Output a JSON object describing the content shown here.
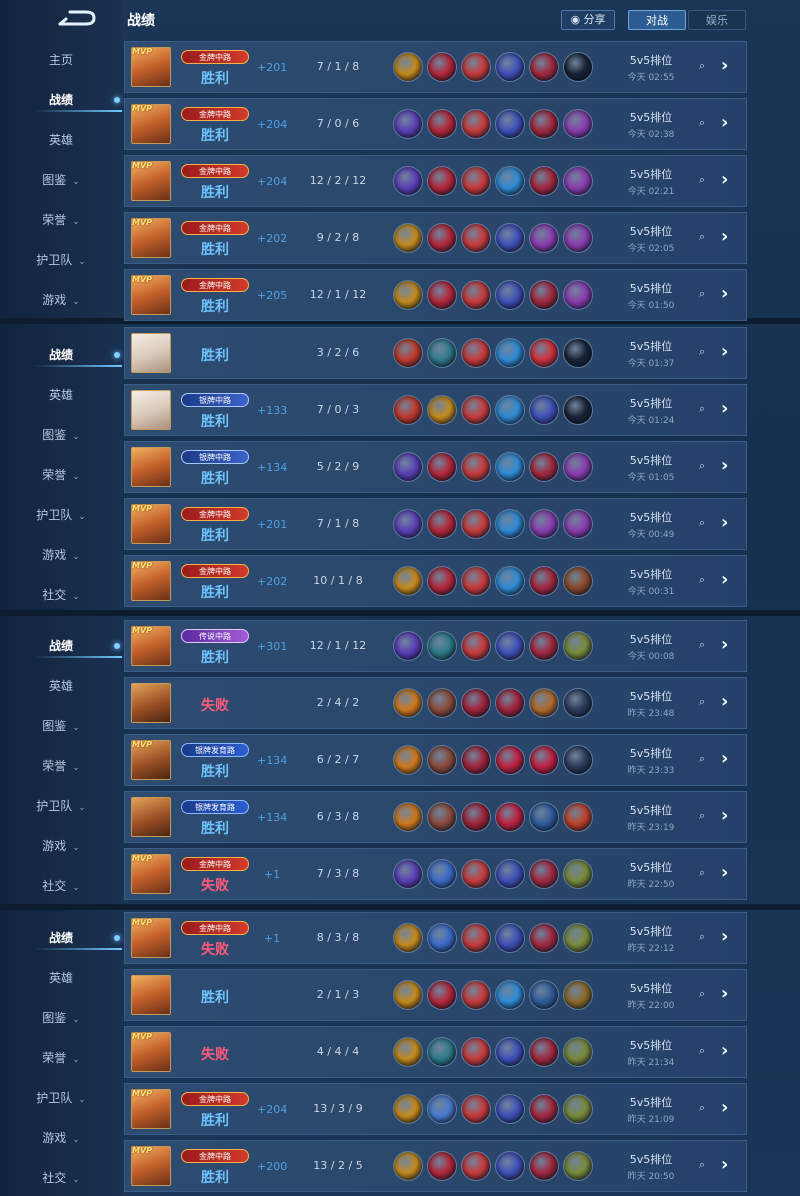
{
  "header": {
    "title": "战绩",
    "share_label": "分享",
    "tab_battle": "对战",
    "tab_fun": "娱乐"
  },
  "sidebar_segments": [
    {
      "items": [
        {
          "label": "主页",
          "caret": false,
          "active": false
        },
        {
          "label": "战绩",
          "caret": false,
          "active": true
        },
        {
          "label": "英雄",
          "caret": false,
          "active": false
        },
        {
          "label": "图鉴",
          "caret": true,
          "active": false
        },
        {
          "label": "荣誉",
          "caret": true,
          "active": false
        },
        {
          "label": "护卫队",
          "caret": true,
          "active": false
        },
        {
          "label": "游戏",
          "caret": true,
          "active": false
        }
      ]
    },
    {
      "items": [
        {
          "label": "战绩",
          "caret": false,
          "active": true
        },
        {
          "label": "英雄",
          "caret": false,
          "active": false
        },
        {
          "label": "图鉴",
          "caret": true,
          "active": false
        },
        {
          "label": "荣誉",
          "caret": true,
          "active": false
        },
        {
          "label": "护卫队",
          "caret": true,
          "active": false
        },
        {
          "label": "游戏",
          "caret": true,
          "active": false
        },
        {
          "label": "社交",
          "caret": true,
          "active": false
        }
      ]
    },
    {
      "items": [
        {
          "label": "战绩",
          "caret": false,
          "active": true
        },
        {
          "label": "英雄",
          "caret": false,
          "active": false
        },
        {
          "label": "图鉴",
          "caret": true,
          "active": false
        },
        {
          "label": "荣誉",
          "caret": true,
          "active": false
        },
        {
          "label": "护卫队",
          "caret": true,
          "active": false
        },
        {
          "label": "游戏",
          "caret": true,
          "active": false
        },
        {
          "label": "社交",
          "caret": true,
          "active": false
        }
      ]
    },
    {
      "items": [
        {
          "label": "战绩",
          "caret": false,
          "active": true
        },
        {
          "label": "英雄",
          "caret": false,
          "active": false
        },
        {
          "label": "图鉴",
          "caret": true,
          "active": false
        },
        {
          "label": "荣誉",
          "caret": true,
          "active": false
        },
        {
          "label": "护卫队",
          "caret": true,
          "active": false
        },
        {
          "label": "游戏",
          "caret": true,
          "active": false
        },
        {
          "label": "社交",
          "caret": true,
          "active": false
        }
      ]
    }
  ],
  "mvp_label": "MVP",
  "matches": [
    {
      "hero": "girl",
      "mvp": true,
      "badge": "金牌中路",
      "badge_style": "gold",
      "result": "胜利",
      "win": true,
      "points": "+201",
      "kda": "7 / 1 / 8",
      "mode": "5v5排位",
      "time": "今天 02:55",
      "items": [
        "#c58a1c",
        "#b3263a",
        "#c73b3b",
        "#3f4fb8",
        "#a1283f",
        "#1a2436"
      ]
    },
    {
      "hero": "girl",
      "mvp": true,
      "badge": "金牌中路",
      "badge_style": "gold",
      "result": "胜利",
      "win": true,
      "points": "+204",
      "kda": "7 / 0 / 6",
      "mode": "5v5排位",
      "time": "今天 02:38",
      "items": [
        "#5a3fb6",
        "#b3263a",
        "#c73b3b",
        "#3f4fb8",
        "#a1283f",
        "#8a3db0"
      ]
    },
    {
      "hero": "girl",
      "mvp": true,
      "badge": "金牌中路",
      "badge_style": "gold",
      "result": "胜利",
      "win": true,
      "points": "+204",
      "kda": "12 / 2 / 12",
      "mode": "5v5排位",
      "time": "今天 02:21",
      "items": [
        "#5a3fb6",
        "#b3263a",
        "#c73b3b",
        "#2f8ad6",
        "#a1283f",
        "#8a3db0"
      ]
    },
    {
      "hero": "girl",
      "mvp": true,
      "badge": "金牌中路",
      "badge_style": "gold",
      "result": "胜利",
      "win": true,
      "points": "+202",
      "kda": "9 / 2 / 8",
      "mode": "5v5排位",
      "time": "今天 02:05",
      "items": [
        "#c58a1c",
        "#b3263a",
        "#c73b3b",
        "#3f4fb8",
        "#8a3db0",
        "#8a3db0"
      ]
    },
    {
      "hero": "girl",
      "mvp": true,
      "badge": "金牌中路",
      "badge_style": "gold",
      "result": "胜利",
      "win": true,
      "points": "+205",
      "kda": "12 / 1 / 12",
      "mode": "5v5排位",
      "time": "今天 01:50",
      "items": [
        "#c58a1c",
        "#b3263a",
        "#c73b3b",
        "#3f4fb8",
        "#a1283f",
        "#8a3db0"
      ]
    },
    {
      "hero": "white",
      "mvp": false,
      "badge": "",
      "badge_style": "",
      "result": "胜利",
      "win": true,
      "points": "",
      "kda": "3 / 2 / 6",
      "mode": "5v5排位",
      "time": "今天 01:37",
      "items": [
        "#c0392b",
        "#2f7a8a",
        "#c73b3b",
        "#2f8ad6",
        "#d0313c",
        "#1a2436"
      ]
    },
    {
      "hero": "white",
      "mvp": false,
      "badge": "银牌中路",
      "badge_style": "silver",
      "result": "胜利",
      "win": true,
      "points": "+133",
      "kda": "7 / 0 / 3",
      "mode": "5v5排位",
      "time": "今天 01:24",
      "items": [
        "#c0392b",
        "#c58a1c",
        "#c73b3b",
        "#2f8ad6",
        "#3f4fb8",
        "#1a2436"
      ]
    },
    {
      "hero": "girl",
      "mvp": false,
      "badge": "银牌中路",
      "badge_style": "silver",
      "result": "胜利",
      "win": true,
      "points": "+134",
      "kda": "5 / 2 / 9",
      "mode": "5v5排位",
      "time": "今天 01:05",
      "items": [
        "#5a3fb6",
        "#b3263a",
        "#c73b3b",
        "#2f8ad6",
        "#a1283f",
        "#8a3db0"
      ]
    },
    {
      "hero": "girl",
      "mvp": true,
      "badge": "金牌中路",
      "badge_style": "gold",
      "result": "胜利",
      "win": true,
      "points": "+201",
      "kda": "7 / 1 / 8",
      "mode": "5v5排位",
      "time": "今天 00:49",
      "items": [
        "#5a3fb6",
        "#b3263a",
        "#c73b3b",
        "#2f8ad6",
        "#8a3db0",
        "#8a3db0"
      ]
    },
    {
      "hero": "girl",
      "mvp": true,
      "badge": "金牌中路",
      "badge_style": "gold",
      "result": "胜利",
      "win": true,
      "points": "+202",
      "kda": "10 / 1 / 8",
      "mode": "5v5排位",
      "time": "今天 00:31",
      "items": [
        "#c58a1c",
        "#b3263a",
        "#c73b3b",
        "#2f8ad6",
        "#a1283f",
        "#8b4a2a"
      ]
    },
    {
      "hero": "girl",
      "mvp": true,
      "badge": "传说中路",
      "badge_style": "purple",
      "result": "胜利",
      "win": true,
      "points": "+301",
      "kda": "12 / 1 / 12",
      "mode": "5v5排位",
      "time": "今天 00:08",
      "items": [
        "#5a3fb6",
        "#2f7a8a",
        "#c73b3b",
        "#3f4fb8",
        "#a1283f",
        "#7a8a3a"
      ]
    },
    {
      "hero": "man",
      "mvp": false,
      "badge": "",
      "badge_style": "",
      "result": "失败",
      "win": false,
      "points": "",
      "kda": "2 / 4 / 2",
      "mode": "5v5排位",
      "time": "昨天 23:48",
      "items": [
        "#d0781c",
        "#8a4a3a",
        "#a0233a",
        "#a0233a",
        "#b06a2a",
        "#2a3a5a"
      ]
    },
    {
      "hero": "man",
      "mvp": true,
      "badge": "银牌发育路",
      "badge_style": "blue",
      "result": "胜利",
      "win": true,
      "points": "+134",
      "kda": "6 / 2 / 7",
      "mode": "5v5排位",
      "time": "昨天 23:33",
      "items": [
        "#d0781c",
        "#8a4a3a",
        "#a0233a",
        "#c02040",
        "#c02040",
        "#2a3a5a"
      ]
    },
    {
      "hero": "man",
      "mvp": false,
      "badge": "银牌发育路",
      "badge_style": "blue",
      "result": "胜利",
      "win": true,
      "points": "+134",
      "kda": "6 / 3 / 8",
      "mode": "5v5排位",
      "time": "昨天 23:19",
      "items": [
        "#d0781c",
        "#8a4a3a",
        "#a0233a",
        "#c02040",
        "#2f5a9a",
        "#c0402a"
      ]
    },
    {
      "hero": "girl",
      "mvp": true,
      "badge": "金牌中路",
      "badge_style": "gold",
      "result": "失败",
      "win": false,
      "points": "+1",
      "kda": "7 / 3 / 8",
      "mode": "5v5排位",
      "time": "昨天 22:50",
      "items": [
        "#5a3fb6",
        "#3a6ac8",
        "#c73b3b",
        "#3f4fb8",
        "#a1283f",
        "#7a8a3a"
      ]
    },
    {
      "hero": "girl",
      "mvp": true,
      "badge": "金牌中路",
      "badge_style": "gold",
      "result": "失败",
      "win": false,
      "points": "+1",
      "kda": "8 / 3 / 8",
      "mode": "5v5排位",
      "time": "昨天 22:12",
      "items": [
        "#c58a1c",
        "#3a6ac8",
        "#c73b3b",
        "#3f4fb8",
        "#a1283f",
        "#7a8a3a"
      ]
    },
    {
      "hero": "girl",
      "mvp": false,
      "badge": "",
      "badge_style": "",
      "result": "胜利",
      "win": true,
      "points": "",
      "kda": "2 / 1 / 3",
      "mode": "5v5排位",
      "time": "昨天 22:00",
      "items": [
        "#c58a1c",
        "#b3263a",
        "#c73b3b",
        "#2f8ad6",
        "#2f5a9a",
        "#8b6a2a"
      ]
    },
    {
      "hero": "girl",
      "mvp": true,
      "badge": "",
      "badge_style": "",
      "result": "失败",
      "win": false,
      "points": "",
      "kda": "4 / 4 / 4",
      "mode": "5v5排位",
      "time": "昨天 21:34",
      "items": [
        "#c58a1c",
        "#2f7a8a",
        "#c73b3b",
        "#3f4fb8",
        "#a1283f",
        "#7a8a3a"
      ]
    },
    {
      "hero": "girl",
      "mvp": true,
      "badge": "金牌中路",
      "badge_style": "gold",
      "result": "胜利",
      "win": true,
      "points": "+204",
      "kda": "13 / 3 / 9",
      "mode": "5v5排位",
      "time": "昨天 21:09",
      "items": [
        "#c58a1c",
        "#4a7ad0",
        "#c73b3b",
        "#3f4fb8",
        "#a1283f",
        "#7a8a3a"
      ]
    },
    {
      "hero": "girl",
      "mvp": true,
      "badge": "金牌中路",
      "badge_style": "gold",
      "result": "胜利",
      "win": true,
      "points": "+200",
      "kda": "13 / 2 / 5",
      "mode": "5v5排位",
      "time": "昨天 20:50",
      "items": [
        "#c58a1c",
        "#b3263a",
        "#c73b3b",
        "#3f4fb8",
        "#a1283f",
        "#7a8a3a"
      ]
    }
  ]
}
